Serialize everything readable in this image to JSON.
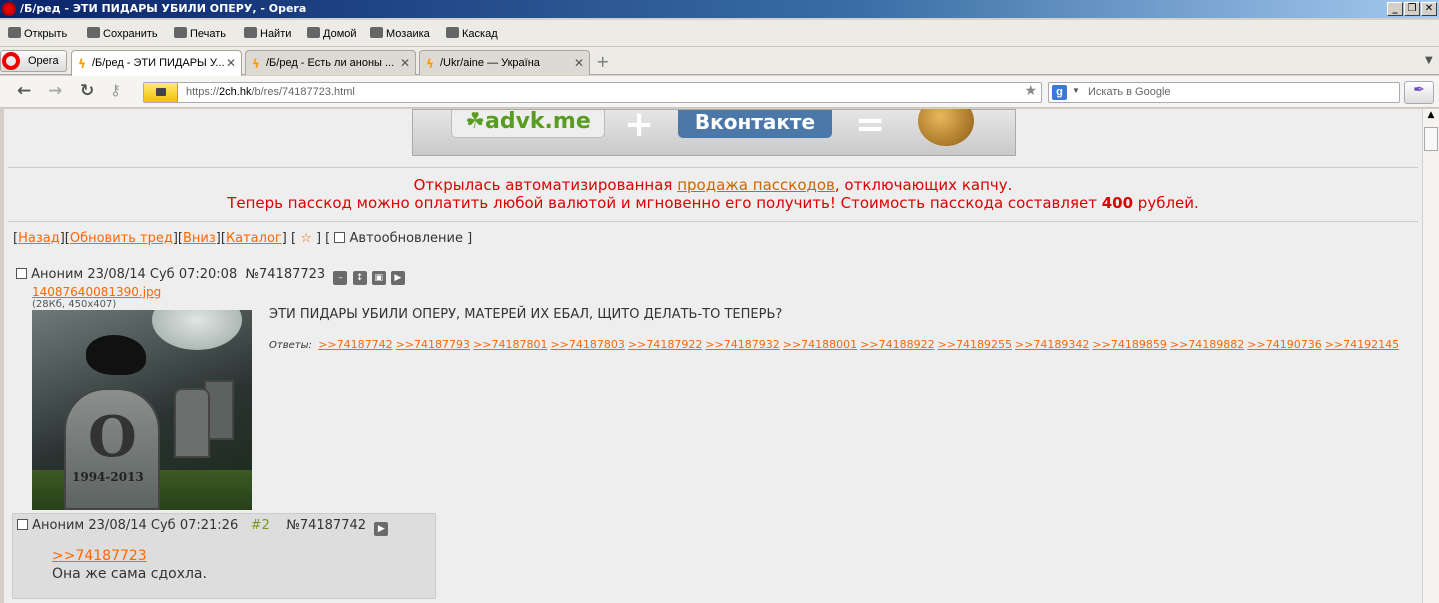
{
  "window": {
    "title": "/Б/ред - ЭТИ ПИДАРЫ УБИЛИ ОПЕРУ, - Opera",
    "min": "_",
    "max": "❐",
    "close": "✕"
  },
  "menubar": {
    "items": [
      {
        "label": "Открыть",
        "icon": "folder-icon"
      },
      {
        "label": "Сохранить",
        "icon": "save-icon"
      },
      {
        "label": "Печать",
        "icon": "print-icon"
      },
      {
        "label": "Найти",
        "icon": "search-icon"
      },
      {
        "label": "Домой",
        "icon": "home-icon"
      },
      {
        "label": "Мозаика",
        "icon": "tile-icon"
      },
      {
        "label": "Каскад",
        "icon": "cascade-icon"
      }
    ]
  },
  "tabs": {
    "opera_label": "Opera",
    "items": [
      {
        "label": "/Б/ред - ЭТИ ПИДАРЫ У...",
        "active": true
      },
      {
        "label": "/Б/ред - Есть ли аноны ...",
        "active": false
      },
      {
        "label": "/Ukr/aine — Україна",
        "active": false
      }
    ]
  },
  "address": {
    "url_prefix": "https://",
    "url_domain": "2ch.hk",
    "url_path": "/b/res/74187723.html",
    "search_placeholder": "Искать в Google",
    "search_engine_letter": "g"
  },
  "banner": {
    "left": "☘advk.me",
    "plus": "+",
    "right": "Вконтакте",
    "equals": "="
  },
  "notice": {
    "line1_a": "Открылась автоматизированная ",
    "line1_link": "продажа пасскодов",
    "line1_b": ", отключающих капчу.",
    "line2_a": "Теперь пасскод можно оплатить любой валютой и мгновенно его получить! Стоимость пасскода составляет ",
    "line2_price": "400",
    "line2_b": " рублей."
  },
  "navlinks": {
    "back": "Назад",
    "refresh": "Обновить тред",
    "down": "Вниз",
    "catalog": "Каталог",
    "star": "☆",
    "autoupdate": "Автообновление"
  },
  "op": {
    "name": "Аноним",
    "date": "23/08/14 Суб 07:20:08",
    "num": "№74187723",
    "file": "14087640081390.jpg",
    "fileinfo": "(28Кб, 450x407)",
    "text": "ЭТИ ПИДАРЫ УБИЛИ ОПЕРУ, МАТЕРЕЙ ИХ ЕБАЛ, ЩИТО ДЕЛАТЬ-ТО ТЕПЕРЬ?",
    "replies_label": "Ответы:",
    "replies": [
      ">>74187742",
      ">>74187793",
      ">>74187801",
      ">>74187803",
      ">>74187922",
      ">>74187932",
      ">>74188001",
      ">>74188922",
      ">>74189255",
      ">>74189342",
      ">>74189859",
      ">>74189882",
      ">>74190736",
      ">>74192145"
    ],
    "image_years": "1994-2013",
    "image_letter": "O"
  },
  "reply": {
    "name": "Аноним",
    "date": "23/08/14 Суб 07:21:26",
    "index": "#2",
    "num": "№74187742",
    "link": ">>74187723",
    "text": "Она же сама сдохла."
  }
}
